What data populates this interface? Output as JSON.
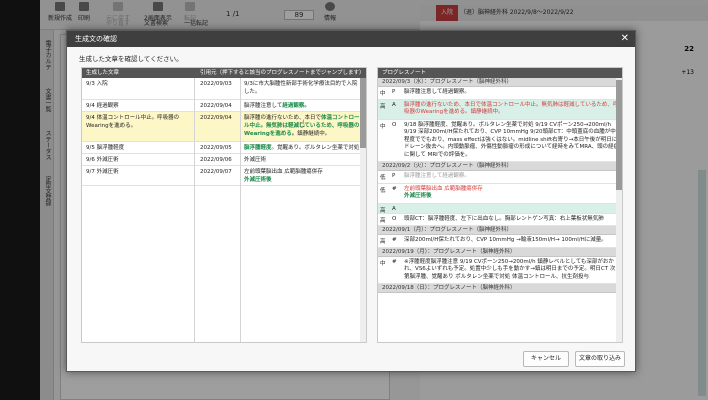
{
  "toolbar": {
    "items": [
      {
        "label": "新規作成",
        "icon": "new-document-icon"
      },
      {
        "label": "印刷",
        "icon": "printer-icon"
      },
      {
        "label": "元に戻す",
        "icon": "undo-icon"
      },
      {
        "label": "やり直す",
        "icon": "redo-icon"
      },
      {
        "label": "2画面表示",
        "icon": "split-view-icon"
      },
      {
        "label": "文書検索",
        "icon": "search-icon"
      },
      {
        "label": "転記",
        "icon": "transcribe-icon"
      },
      {
        "label": "一括転記",
        "icon": "bulk-transcribe-icon"
      },
      {
        "label": "情報",
        "icon": "info-icon"
      }
    ],
    "page_current": "1",
    "page_total": "/1",
    "zoom": "89"
  },
  "left_tabs": [
    "電子カルテ",
    "文書一覧",
    "ステータス",
    "定型文登録"
  ],
  "right_header": {
    "badge": "入院",
    "text": "（退）脳神経外科 2022/9/8〜2022/9/22"
  },
  "right_numbers": [
    "22",
    "+13"
  ],
  "dialog": {
    "title": "生成文の確認",
    "subtitle": "生成した文章を確認してください。",
    "left_headers": {
      "generated": "生成した文章",
      "source": "引用元（押下すると該当のプログレスノートまでジャンプします）"
    },
    "rows": [
      {
        "text": "9/3 入院",
        "date": "2022/09/03",
        "source": "9/3に市大脳腫性新部手術化学療法目的で入院した。",
        "source_highlight": ""
      },
      {
        "text": "9/4 経過観察",
        "date": "2022/09/04",
        "source": "脳浮腫注意して",
        "source_highlight": "経過観察。"
      },
      {
        "text": "9/4 体温コントロール中止。呼吸器のWearingを進める。",
        "date": "2022/09/04",
        "source": "脳浮腫の進行ないため、本日で",
        "source_highlight": "体温コントロール中止。無気肺は軽減しているため、呼吸器のWearingを進める。",
        "source_tail": "鎮静継続中。",
        "selected": true
      },
      {
        "text": "9/5 脳浮腫軽度",
        "date": "2022/09/05",
        "source": "",
        "source_highlight": "脳浮腫軽度",
        "source_tail": "。覚醒あり。ボルタレン坐薬で対処"
      },
      {
        "text": "9/6 外減圧術",
        "date": "2022/09/06",
        "source": "外減圧術",
        "source_highlight": ""
      },
      {
        "text": "9/7 外減圧術",
        "date": "2022/09/07",
        "source": "左前頭葉脳出血 広範脳腫瘍併存",
        "source_highlight": "外減圧術後"
      }
    ],
    "progress_title": "プログレスノート",
    "progress": [
      {
        "day": "2022/09/3（水）：プログレスノート（脳神経外科）",
        "entries": [
          {
            "k1": "中",
            "k2": "P",
            "text": "脳浮腫注意して経過観察。",
            "cls": ""
          },
          {
            "k1": "高",
            "k2": "A",
            "text": "脳浮腫の進行ないため、本日で体温コントロール中止。無気肺は軽減しているため、呼吸器のWearingを進める。鎮静継続中。",
            "cls": "teal",
            "red_part": "脳浮腫の進行ないため、本日で体温コントロール中止。"
          },
          {
            "k1": "中",
            "k2": "O",
            "text": "9/18 脳浮腫軽度、覚醒あり。ボルタレン坐薬で対処 9/19 CVポーン250→200ml/h 9/19 深部200ml/H保たれており、CVP 10mmHg 9/20頭部CT：中頭蓋底の血腫が中程度ででもおり、mass effectは強くはない。midline shift右寄り→本日午後が明日にドレーン抜去へ。内頭動脈瘤、外傷性動脈瘤の形成について経時をみてMRA、頭の経症に関して MRIでの評価を。",
            "cls": "",
            "red_part": ""
          }
        ]
      },
      {
        "day": "2022/09/2（火）：プログレスノート（脳神経外科）",
        "entries": [
          {
            "k1": "低",
            "k2": "P",
            "text": "脳浮腫注意して経過観察。",
            "cls": "",
            "gray": true
          },
          {
            "k1": "低",
            "k2": "#",
            "text": "左前頭葉脳出血 広範脳腫瘍併存 外減圧術後",
            "cls": "",
            "red_part": "左前頭葉脳出血 広範脳腫瘍併存",
            "green_part": "外減圧術後"
          },
          {
            "k1": "高",
            "k2": "A",
            "text": "",
            "cls": "teal"
          },
          {
            "k1": "高",
            "k2": "O",
            "text": "頭部CT：脳浮腫軽度、左下に出血なし。胸部レントゲン写真：右上葉板状無気肺",
            "cls": "",
            "red_part": "頭部CT：脳浮腫軽度、左下に出血なし。"
          }
        ]
      },
      {
        "day": "2022/09/1（月）：プログレスノート（脳神経外科）",
        "entries": [
          {
            "k1": "高",
            "k2": "#",
            "text": "深部200ml/H保たれており、CVP 10mmHg →輸液150ml/H→ 100ml/Hに減量。",
            "cls": "",
            "gray_part": "深部200ml/H保たれており、CVP 10mmHg"
          }
        ]
      },
      {
        "day": "2022/09/19（月）：プログレスノート（脳神経外科）",
        "entries": [
          {
            "k1": "中",
            "k2": "#",
            "text": "※浮腫軽度脳浮腫注意 9/19 CVポーン250→200ml/h 鎮静レベルとしても深部がおかれ、VS6よいずれも予定。処置中少しも手を動かす→鎮は明日までの予定。明日CT 次第脳浮腫、覚醒あり ポルタレン坐薬で対処 体温コントロール、抗生剤投与",
            "cls": ""
          }
        ]
      },
      {
        "day": "2022/09/18（日）：プログレスノート（脳神経外科）",
        "entries": []
      }
    ],
    "cancel_label": "キャンセル",
    "import_label": "文章の取り込み"
  },
  "colors": {
    "accent_green": "#1a8a4a",
    "alert_red": "#d23a3a",
    "teal_bg": "#d8f0e8",
    "selected_row": "#fdf6c6"
  }
}
